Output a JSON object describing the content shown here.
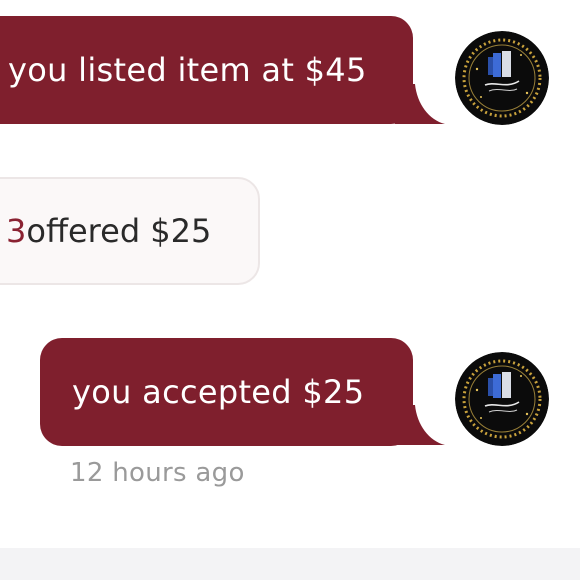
{
  "messages": [
    {
      "sender": "self",
      "text": "you listed item at $45"
    },
    {
      "sender": "other",
      "username_fragment": "3",
      "text": " offered $25"
    },
    {
      "sender": "self",
      "text": "you accepted $25"
    }
  ],
  "timestamp": "12 hours ago",
  "colors": {
    "outgoing_bubble": "#7f1f2d",
    "outgoing_text": "#ffffff",
    "incoming_bubble": "#fbf8f8",
    "username_link": "#8a2232",
    "timestamp": "#9a9a9a"
  },
  "avatar": {
    "icon": "closet-logo-avatar",
    "logo_text": "Jada's Closet"
  }
}
